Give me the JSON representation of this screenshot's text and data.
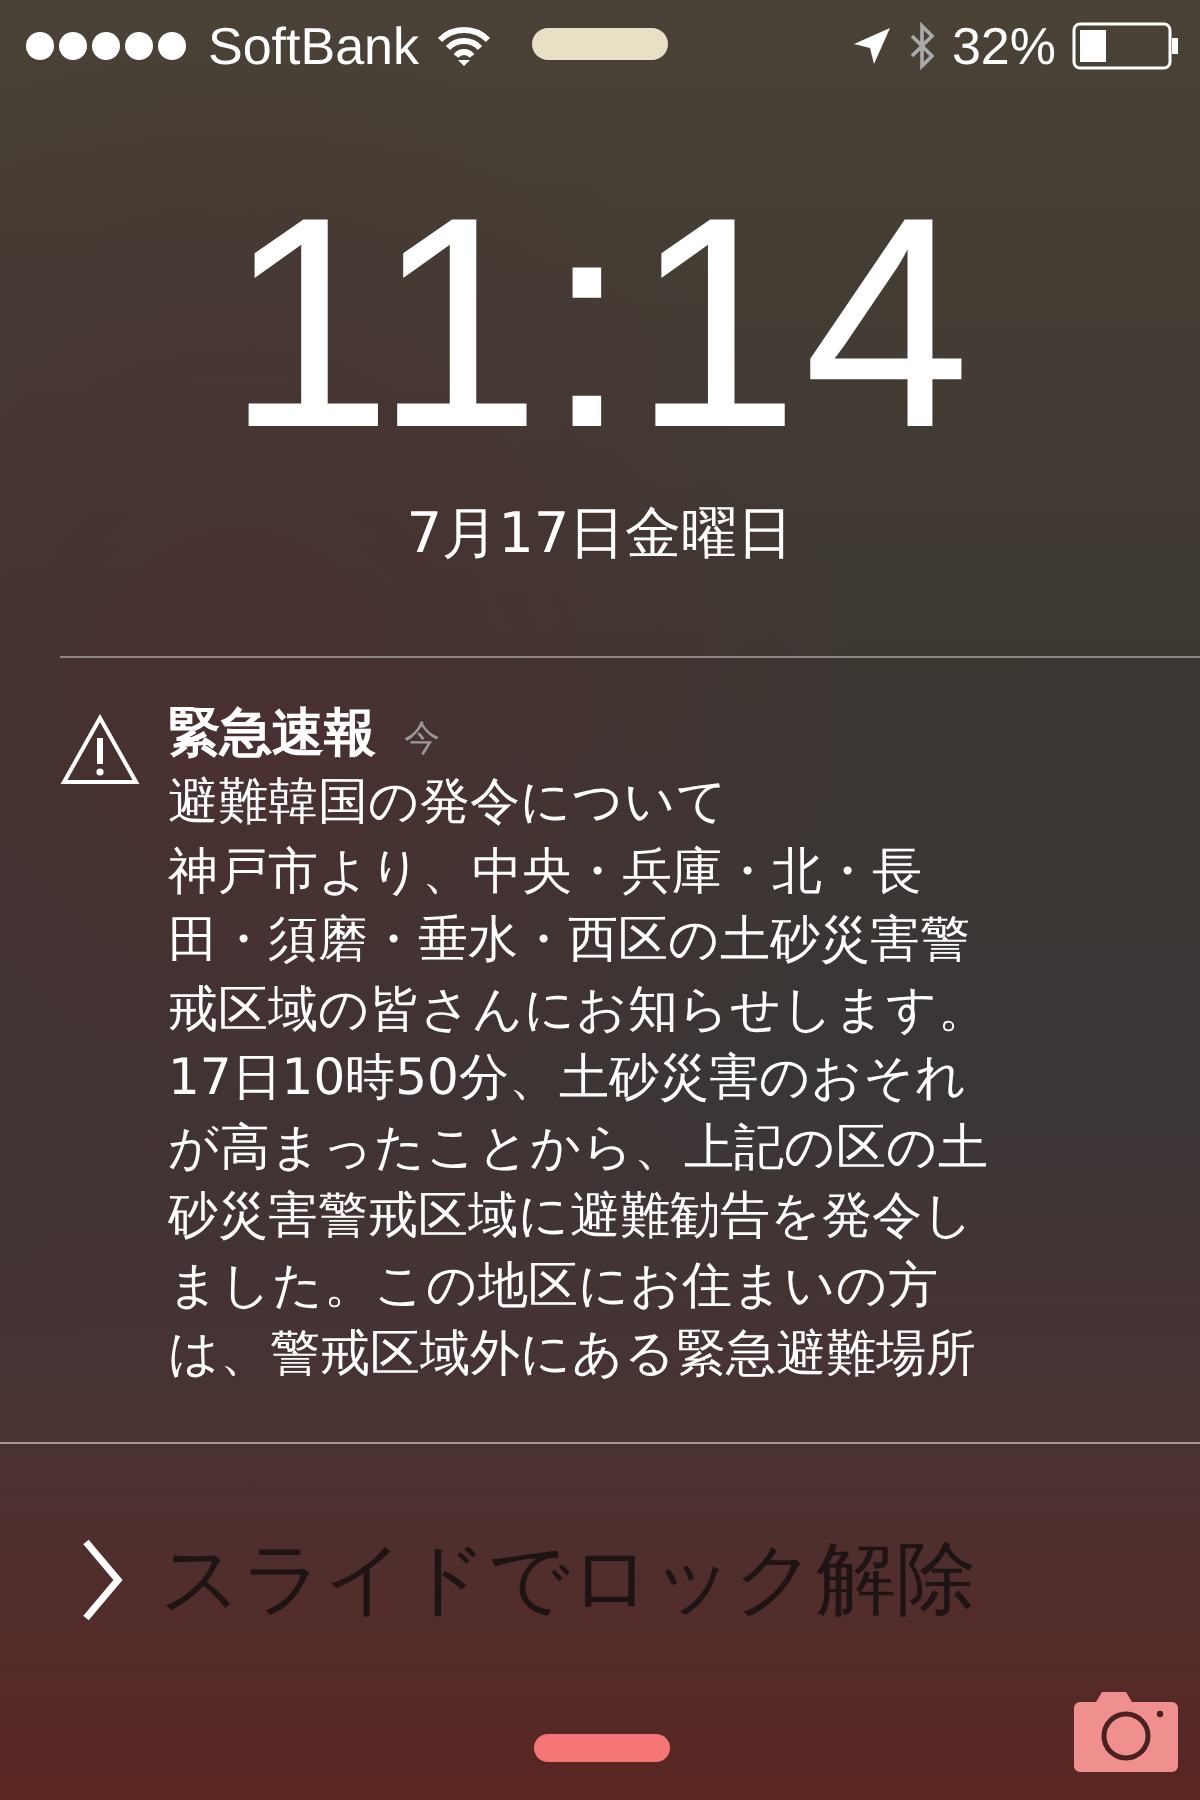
{
  "status_bar": {
    "carrier": "SoftBank",
    "battery": "32%"
  },
  "clock": {
    "time": "11:14",
    "date": "7月17日金曜日"
  },
  "notification": {
    "app": "緊急速報",
    "time": "今",
    "lines": [
      "避難韓国の発令について",
      "神戸市より、中央・兵庫・北・長",
      "田・須磨・垂水・西区の土砂災害警",
      "戒区域の皆さんにお知らせします。",
      "17日10時50分、土砂災害のおそれ",
      "が高まったことから、上記の区の土",
      "砂災害警戒区域に避難勧告を発令し",
      "ました。この地区にお住まいの方",
      "は、警戒区域外にある緊急避難場所"
    ]
  },
  "unlock": {
    "label": "スライドでロック解除"
  }
}
